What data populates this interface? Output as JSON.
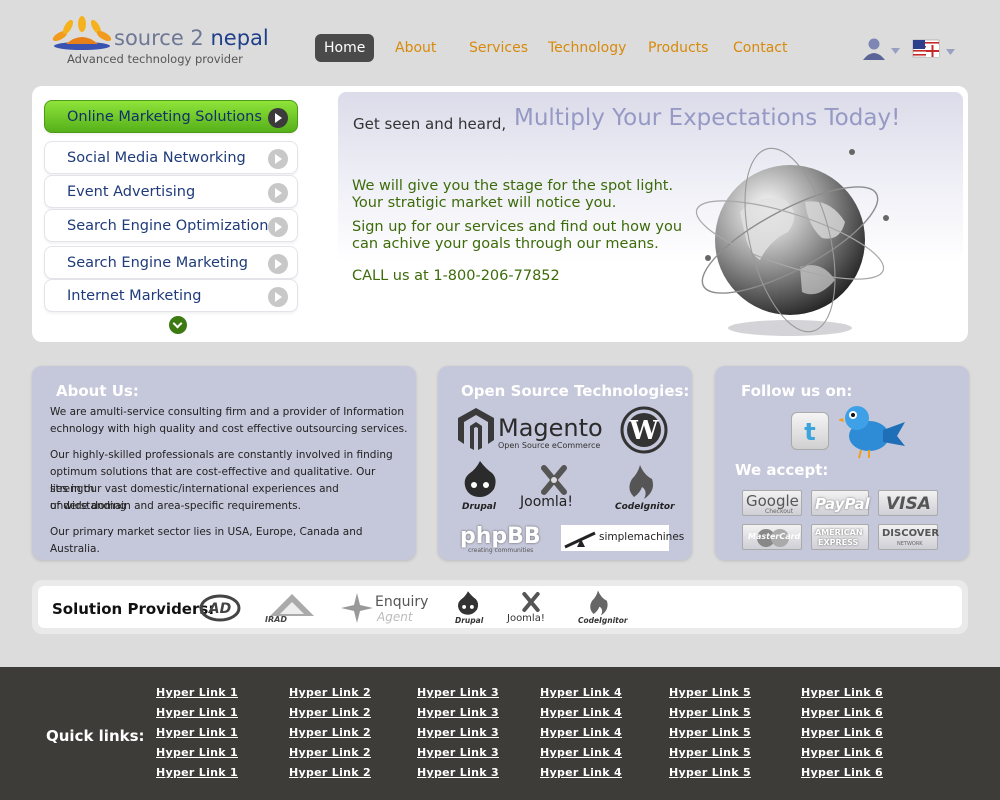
{
  "header": {
    "logo": {
      "name_part1": "source 2",
      "name_part2": "nepal",
      "tagline": "Advanced technology provider"
    },
    "nav": [
      {
        "label": "Home",
        "active": true
      },
      {
        "label": "About"
      },
      {
        "label": "Services"
      },
      {
        "label": "Technology"
      },
      {
        "label": "Products"
      },
      {
        "label": "Contact"
      }
    ],
    "icons": [
      "user-icon",
      "flag-icon"
    ]
  },
  "hero": {
    "menu": [
      {
        "label": "Online Marketing Solutions",
        "active": true
      },
      {
        "label": "Social Media Networking"
      },
      {
        "label": "Event Advertising"
      },
      {
        "label": "Search Engine Optimization"
      },
      {
        "label": "Search Engine Marketing"
      },
      {
        "label": "Internet Marketing"
      }
    ],
    "lead": "Get seen and heard,",
    "headline": "Multiply Your Expectations Today!",
    "para1_line1": "We will give you the stage for the spot light.",
    "para1_line2": "Your stratigic market will notice you.",
    "para2_line1": "Sign up for our services and find out how you",
    "para2_line2": "can achive your goals through our means.",
    "call": "CALL us at 1-800-206-77852",
    "accent_color": "#5bb520"
  },
  "about": {
    "title": "About Us:",
    "p1_line1": "We are amulti-service consulting firm and a provider of Information",
    "p1_line2": "echnology with high quality and cost effective outsourcing services.",
    "p2_line1": "Our highly-skilled professionals are constantly involved in finding",
    "p2_line2": "optimum solutions that are cost-effective and qualitative. Our strength",
    "p2_line3": "lies in our vast domestic/international experiences and understanding",
    "p2_line4": "of wide domain and area-specific requirements.",
    "p3": "Our primary market sector lies in USA, Europe, Canada and Australia."
  },
  "tech": {
    "title": "Open Source Technologies:",
    "magento": "Magento",
    "magento_sub": "Open Source eCommerce",
    "drupal": "Drupal",
    "joomla": "Joomla!",
    "codeigniter": "CodeIgnitor",
    "phpbb": "phpBB",
    "phpbb_sub": "creating communities",
    "simplemachines": "simplemachines"
  },
  "follow": {
    "title": "Follow us on:",
    "accept": "We accept:",
    "payments": [
      {
        "label": "Google",
        "sub": "Checkout"
      },
      {
        "label": "PayPal"
      },
      {
        "label": "VISA"
      },
      {
        "label": "MasterCard"
      },
      {
        "label": "AMERICAN",
        "sub": "EXPRESS"
      },
      {
        "label": "DISCOVER",
        "sub": "NETWORK"
      }
    ]
  },
  "solutions": {
    "title": "Solution Providers:",
    "irad": "IRAD",
    "enquiry": "Enquiry",
    "agent": "Agent",
    "drupal": "Drupal",
    "joomla": "Joomla!",
    "codeigniter": "CodeIgnitor"
  },
  "footer": {
    "title": "Quick links:",
    "columns": [
      [
        "Hyper Link 1",
        "Hyper Link 1",
        "Hyper Link 1",
        "Hyper Link 1",
        "Hyper Link 1"
      ],
      [
        "Hyper Link 2",
        "Hyper Link 2",
        "Hyper Link 2",
        "Hyper Link 2",
        "Hyper Link 2"
      ],
      [
        "Hyper Link 3",
        "Hyper Link 3",
        "Hyper Link 3",
        "Hyper Link 3",
        "Hyper Link 3"
      ],
      [
        "Hyper Link 4",
        "Hyper Link 4",
        "Hyper Link 4",
        "Hyper Link 4",
        "Hyper Link 4"
      ],
      [
        "Hyper Link 5",
        "Hyper Link 5",
        "Hyper Link 5",
        "Hyper Link 5",
        "Hyper Link 5"
      ],
      [
        "Hyper Link 6",
        "Hyper Link 6",
        "Hyper Link 6",
        "Hyper Link 6",
        "Hyper Link 6"
      ]
    ]
  }
}
